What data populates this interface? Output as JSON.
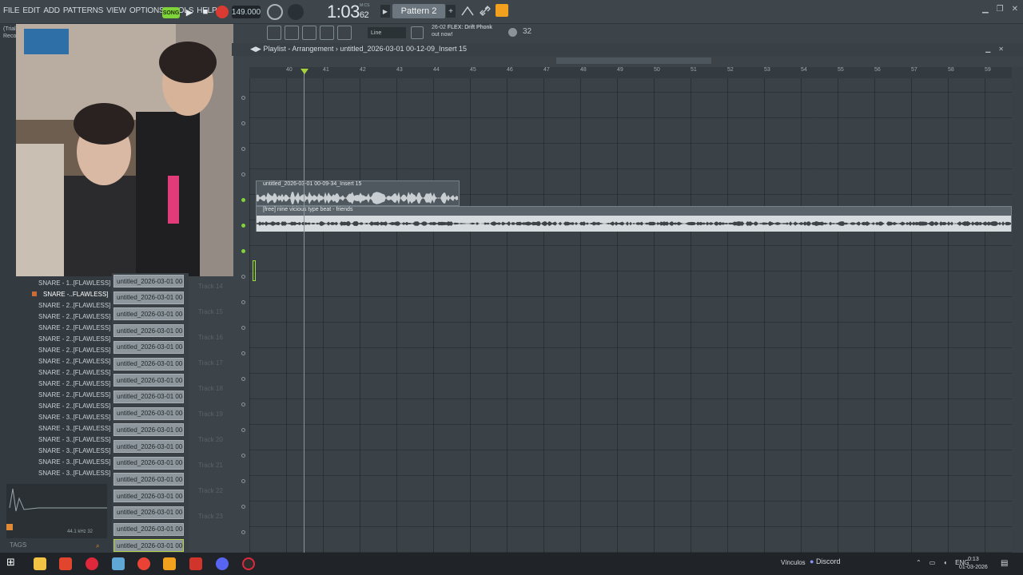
{
  "menu": [
    "FILE",
    "EDIT",
    "ADD",
    "PATTERNS",
    "VIEW",
    "OPTIONS",
    "TOOLS",
    "HELP"
  ],
  "transport": {
    "song_toggle": "SONG",
    "tempo": "149.000",
    "time_main": "1:03",
    "time_sub": "62",
    "time_unit": "M:CS",
    "pattern": "Pattern 2"
  },
  "toolbar2": {
    "snap": "Line",
    "news_code": "26-02",
    "news_title": "FLEX: Drift Phonk",
    "news_sub": "out now!",
    "cpu_label": "32"
  },
  "trial_text": [
    "(Trial",
    "Reco"
  ],
  "browser": {
    "items": [
      "SNARE - 1..[FLAWLESS]",
      "SNARE -..FLAWLESS]",
      "SNARE - 2..[FLAWLESS]",
      "SNARE - 2..[FLAWLESS]",
      "SNARE - 2..[FLAWLESS]",
      "SNARE - 2..[FLAWLESS]",
      "SNARE - 2..[FLAWLESS]",
      "SNARE - 2..[FLAWLESS]",
      "SNARE - 2..[FLAWLESS]",
      "SNARE - 2..[FLAWLESS]",
      "SNARE - 2..[FLAWLESS]",
      "SNARE - 2..[FLAWLESS]",
      "SNARE - 3..[FLAWLESS]",
      "SNARE - 3..[FLAWLESS]",
      "SNARE - 3..[FLAWLESS]",
      "SNARE - 3..[FLAWLESS]",
      "SNARE - 3..[FLAWLESS]",
      "SNARE - 3..[FLAWLESS]"
    ],
    "selected_index": 1,
    "sample_info": "44.1 kHz 32",
    "tags": "TAGS"
  },
  "picker": {
    "items": [
      "untitled_2026-03-01 00-...",
      "untitled_2026-03-01 00-...",
      "untitled_2026-03-01 00-...",
      "untitled_2026-03-01 00-...",
      "untitled_2026-03-01 00-...",
      "untitled_2026-03-01 00-...",
      "untitled_2026-03-01 00-...",
      "untitled_2026-03-01 00-...",
      "untitled_2026-03-01 00-...",
      "untitled_2026-03-01 00-...",
      "untitled_2026-03-01 00-...",
      "untitled_2026-03-01 00-...",
      "untitled_2026-03-01 00-...",
      "untitled_2026-03-01 00-...",
      "untitled_2026-03-01 00-...",
      "untitled_2026-03-01 00-...",
      "untitled_2026-03-01 00-..."
    ]
  },
  "tracks": [
    "Track 14",
    "Track 15",
    "Track 16",
    "Track 17",
    "Track 18",
    "Track 19",
    "Track 20",
    "Track 21",
    "Track 22",
    "Track 23"
  ],
  "playlist": {
    "title": "Playlist - Arrangement",
    "breadcrumb_sep": "›",
    "breadcrumb": "untitled_2026-03-01 00-12-09_Insert 15",
    "bars": [
      "40",
      "41",
      "42",
      "43",
      "44",
      "45",
      "46",
      "47",
      "48",
      "49",
      "50",
      "51",
      "52",
      "53",
      "54",
      "55",
      "56",
      "57",
      "58",
      "59"
    ],
    "clips": [
      {
        "label": "untitled_2026-03-01 00-09-34_Insert 15"
      },
      {
        "label": "[free] nine vicious type beat - friends"
      }
    ]
  },
  "taskbar": {
    "vinculos": "Vínculos",
    "discord": "Discord",
    "lang": "ENG",
    "time": "0:13",
    "date": "01-03-2026"
  },
  "colors": {
    "accent_green": "#7fd43a",
    "record_red": "#d93b32",
    "fl_orange": "#f2a11f"
  }
}
